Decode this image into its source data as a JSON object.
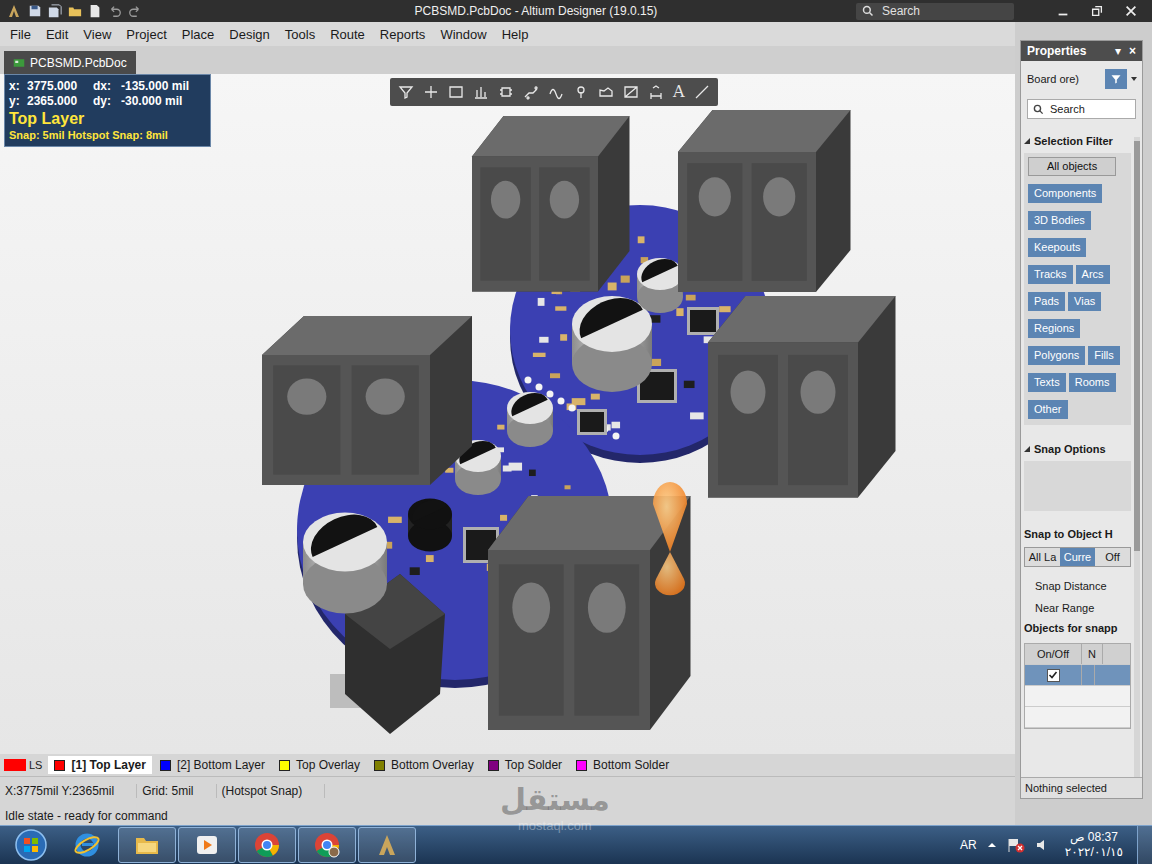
{
  "window": {
    "title": "PCBSMD.PcbDoc - Altium Designer (19.0.15)",
    "search": "Search"
  },
  "menu": [
    "File",
    "Edit",
    "View",
    "Project",
    "Place",
    "Design",
    "Tools",
    "Route",
    "Reports",
    "Window",
    "Help"
  ],
  "document_tabs": [
    {
      "label": "PCBSMD.PcbDoc",
      "selected": true
    }
  ],
  "hud": {
    "x": "x:",
    "x_value": "3775.000",
    "dx": "dx:",
    "dx_value": "-135.000 mil",
    "y": "y:",
    "y_value": "2365.000",
    "dy": "dy:",
    "dy_value": "-30.000 mil",
    "layer": "Top Layer",
    "snap": "Snap: 5mil Hotspot Snap: 8mil"
  },
  "toolbar": {
    "text_tool": "A"
  },
  "layer_set": {
    "label": "LS",
    "color": "#ff0000"
  },
  "layers": [
    {
      "label": "[1] Top Layer",
      "color": "#ff0000",
      "selected": true
    },
    {
      "label": "[2] Bottom Layer",
      "color": "#0000ff",
      "selected": false
    },
    {
      "label": "Top Overlay",
      "color": "#ffff00",
      "selected": false
    },
    {
      "label": "Bottom Overlay",
      "color": "#808000",
      "selected": false
    },
    {
      "label": "Top Solder",
      "color": "#800080",
      "selected": false
    },
    {
      "label": "Bottom Solder",
      "color": "#ff00ff",
      "selected": false
    }
  ],
  "status_bar": {
    "coords": "X:3775mil Y:2365mil",
    "grid": "Grid: 5mil",
    "snap": "(Hotspot Snap)",
    "message": "Idle state - ready for command"
  },
  "properties": {
    "title": "Properties",
    "menu_glyph": "▾",
    "close_glyph": "×",
    "object": "Board ore)",
    "search": "Search",
    "selection_filter": {
      "title": "Selection Filter",
      "expanded": true,
      "items": [
        {
          "label": "All objects",
          "kind": "all",
          "on": true
        },
        {
          "label": "Components",
          "kind": "filter",
          "on": true
        },
        {
          "label": "3D Bodies",
          "kind": "filter",
          "on": true
        },
        {
          "label": "Keepouts",
          "kind": "filter",
          "on": true
        },
        {
          "label": "Tracks",
          "kind": "filter",
          "on": true
        },
        {
          "label": "Arcs",
          "kind": "filter",
          "on": true
        },
        {
          "label": "Pads",
          "kind": "filter",
          "on": true
        },
        {
          "label": "Vias",
          "kind": "filter",
          "on": true
        },
        {
          "label": "Regions",
          "kind": "filter",
          "on": true
        },
        {
          "label": "Polygons",
          "kind": "filter",
          "on": true
        },
        {
          "label": "Fills",
          "kind": "filter",
          "on": true
        },
        {
          "label": "Texts",
          "kind": "filter",
          "on": true
        },
        {
          "label": "Rooms",
          "kind": "filter",
          "on": true
        },
        {
          "label": "Other",
          "kind": "filter",
          "on": true
        }
      ]
    },
    "snap_options": {
      "title": "Snap Options",
      "expanded": true,
      "snap_to_object": "Snap to Object H",
      "modes": [
        {
          "label": "All La",
          "selected": false
        },
        {
          "label": "Curre",
          "selected": true
        },
        {
          "label": "Off",
          "selected": false
        }
      ],
      "snap_distance": "Snap Distance",
      "near_range": "Near Range",
      "objects_title": "Objects for snapp",
      "columns": [
        "On/Off",
        "N"
      ],
      "rows": [
        {
          "checked": true,
          "selected": true
        }
      ]
    },
    "footer": "Nothing selected"
  },
  "taskbar": {
    "apps": [
      {
        "kind": "ie",
        "running": false
      },
      {
        "kind": "explorer",
        "running": true
      },
      {
        "kind": "media",
        "running": true
      },
      {
        "kind": "chrome",
        "running": true
      },
      {
        "kind": "chrome-profile",
        "running": true
      },
      {
        "kind": "altium",
        "running": true
      }
    ],
    "language": "AR",
    "time": "08:37 ص",
    "date": "٢٠٢٢/٠١/١٥"
  },
  "watermark": {
    "brand": "مستقل",
    "url": "mostaql.com"
  }
}
